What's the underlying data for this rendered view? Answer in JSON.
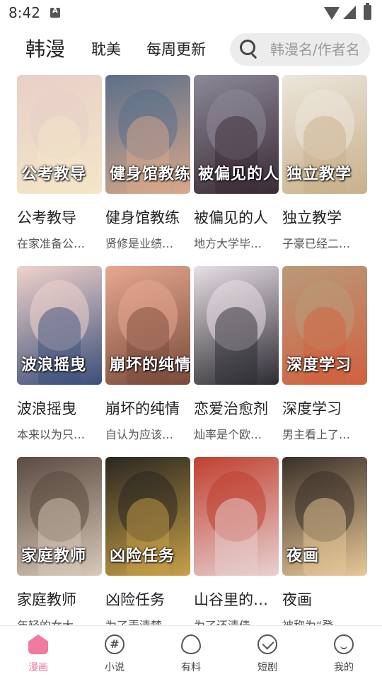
{
  "status_bar": {
    "time": "8:42"
  },
  "top_nav": {
    "tabs": [
      {
        "label": "韩漫",
        "active": true
      },
      {
        "label": "耽美",
        "active": false
      },
      {
        "label": "每周更新",
        "active": false
      }
    ],
    "search": {
      "placeholder": "韩漫名/作者名"
    }
  },
  "comics": [
    {
      "title": "公考教导",
      "desc": "在家准备公…",
      "cover_text": "公考教导",
      "colors": [
        "#e8cfc8",
        "#f4e6c8"
      ]
    },
    {
      "title": "健身馆教练",
      "desc": "贤修是业绩…",
      "cover_text": "健身馆教练",
      "colors": [
        "#5a6f8a",
        "#d9a88a"
      ]
    },
    {
      "title": "被偏见的人",
      "desc": "地方大学毕…",
      "cover_text": "被偏见的人",
      "colors": [
        "#8c8898",
        "#3a2a34"
      ]
    },
    {
      "title": "独立教学",
      "desc": "子豪已经二…",
      "cover_text": "独立教学",
      "colors": [
        "#ece6dc",
        "#c9b08a"
      ]
    },
    {
      "title": "波浪摇曳",
      "desc": "本来以为只…",
      "cover_text": "波浪摇曳",
      "colors": [
        "#f1d3cc",
        "#3a4f7a"
      ]
    },
    {
      "title": "崩坏的纯情",
      "desc": "自认为应该…",
      "cover_text": "崩坏的纯情",
      "colors": [
        "#e6a890",
        "#7a4a3a"
      ]
    },
    {
      "title": "恋爱治愈剂",
      "desc": "灿率是个欧…",
      "cover_text": "",
      "colors": [
        "#e9dfe6",
        "#2c2c30"
      ]
    },
    {
      "title": "深度学习",
      "desc": "男主看上了…",
      "cover_text": "深度学习",
      "colors": [
        "#b89a7a",
        "#d2603e"
      ]
    },
    {
      "title": "家庭教师",
      "desc": "年轻的女大…",
      "cover_text": "家庭教师",
      "colors": [
        "#5a4a40",
        "#d8c8b8"
      ]
    },
    {
      "title": "凶险任务",
      "desc": "为了弄清楚…",
      "cover_text": "凶险任务",
      "colors": [
        "#2a2620",
        "#c8a048"
      ]
    },
    {
      "title": "山谷里的…",
      "desc": "为了还清债…",
      "cover_text": "",
      "colors": [
        "#c04030",
        "#e8d0d0"
      ]
    },
    {
      "title": "夜画",
      "desc": "被称为“登…",
      "cover_text": "夜画",
      "colors": [
        "#3a3028",
        "#e8c898"
      ]
    }
  ],
  "bottom_nav": [
    {
      "label": "漫画",
      "icon": "home-icon",
      "active": true
    },
    {
      "label": "小说",
      "icon": "hash-icon",
      "active": false
    },
    {
      "label": "有料",
      "icon": "egg-icon",
      "active": false
    },
    {
      "label": "短剧",
      "icon": "trend-icon",
      "active": false
    },
    {
      "label": "我的",
      "icon": "profile-icon",
      "active": false
    }
  ],
  "colors": {
    "accent": "#f07aa0",
    "search_bg": "#ececec"
  }
}
